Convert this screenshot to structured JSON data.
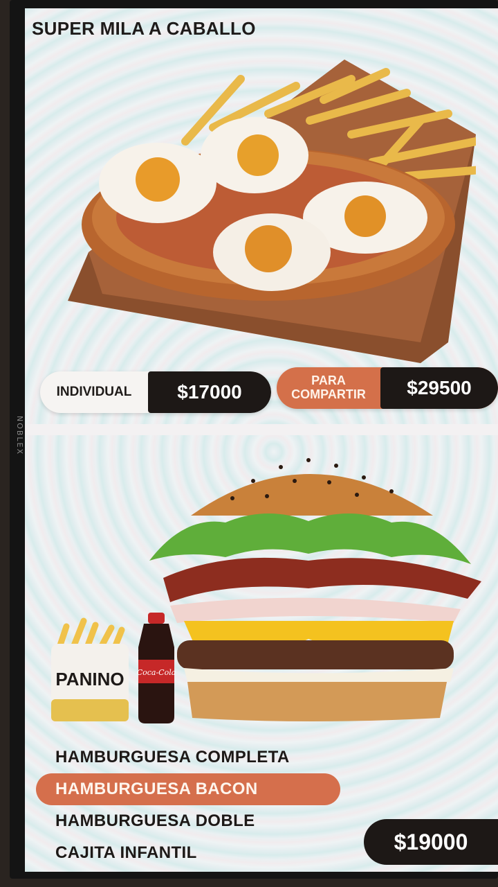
{
  "device": {
    "brand": "NOBLEX"
  },
  "section_top": {
    "title": "SUPER MILA A CABALLO",
    "image_name": "milanesa-with-eggs-and-fries",
    "options": [
      {
        "label": "INDIVIDUAL",
        "price": "$17000"
      },
      {
        "label_line1": "PARA",
        "label_line2": "COMPARTIR",
        "price": "$29500"
      }
    ]
  },
  "section_bottom": {
    "image_name": "bacon-burger-with-fries-and-cola",
    "fries_brand": "PANINO",
    "cola_brand": "Coca-Cola",
    "items": [
      {
        "label": "HAMBURGUESA COMPLETA",
        "active": false
      },
      {
        "label": "HAMBURGUESA BACON",
        "active": true
      },
      {
        "label": "HAMBURGUESA DOBLE",
        "active": false
      },
      {
        "label": "CAJITA INFANTIL",
        "active": false
      }
    ],
    "price": "$19000"
  },
  "colors": {
    "accent_orange": "#d56f4c",
    "price_dark": "#1d1816",
    "text_dark": "#1e1b1a"
  }
}
